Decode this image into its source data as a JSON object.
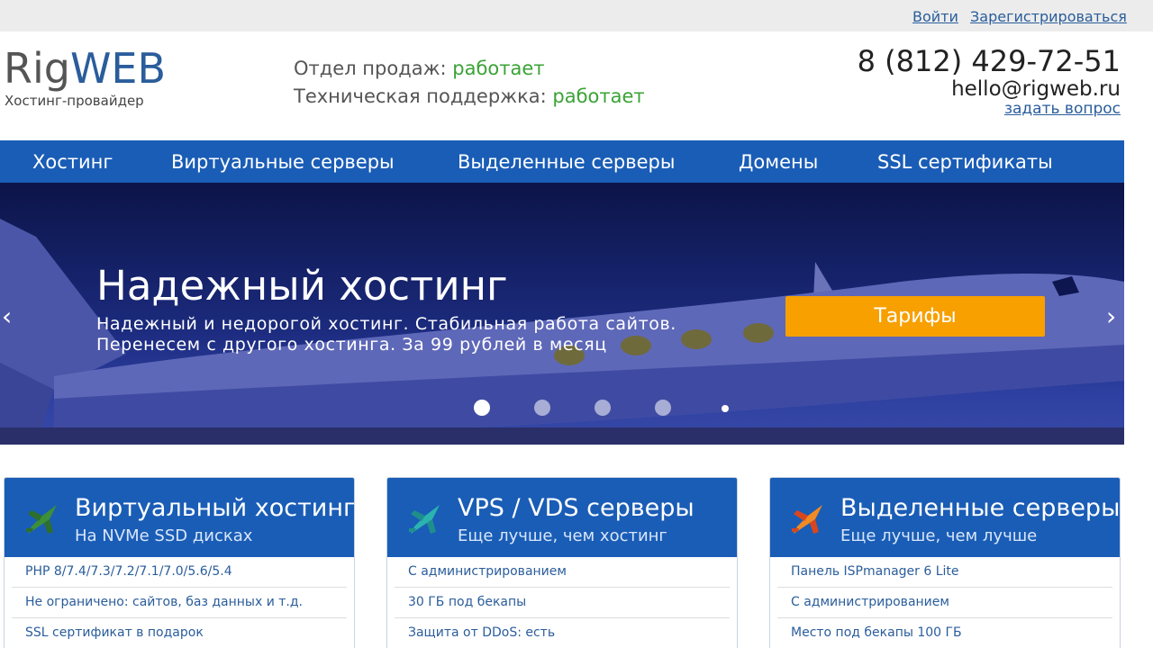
{
  "topbar": {
    "login": "Войти",
    "register": "Зарегистрироваться"
  },
  "header": {
    "logo_part1": "Rig",
    "logo_part2": "WEB",
    "tagline": "Хостинг-провайдер",
    "sales_label": "Отдел продаж:",
    "sales_status": "работает",
    "support_label": "Техническая поддержка:",
    "support_status": "работает",
    "phone": "8 (812) 429-72-51",
    "email": "hello@rigweb.ru",
    "ask_link": "задать вопрос",
    "status_color": "#3aa335"
  },
  "nav": {
    "items": [
      {
        "label": "Хостинг"
      },
      {
        "label": "Виртуальные серверы"
      },
      {
        "label": "Выделенные серверы"
      },
      {
        "label": "Домены"
      },
      {
        "label": "SSL сертификаты"
      }
    ],
    "background": "#1a5db6"
  },
  "hero": {
    "title": "Надежный хостинг",
    "text_line1": "Надежный и недорогой хостинг. Стабильная работа сайтов.",
    "text_line2": "Перенесем с другого хостинга. За 99 рублей в месяц",
    "button": "Тарифы",
    "button_color": "#f7a000",
    "prev_icon": "‹",
    "next_icon": "›",
    "slides_total": 4,
    "active_slide": 1
  },
  "cards": [
    {
      "title": "Виртуальный хостинг",
      "subtitle": "На NVMe SSD дисках",
      "icon": "green-jet-icon",
      "features": [
        "PHP 8/7.4/7.3/7.2/7.1/7.0/5.6/5.4",
        "Не ограничено: сайтов, баз данных и т.д.",
        "SSL сертификат в подарок"
      ]
    },
    {
      "title": "VPS / VDS серверы",
      "subtitle": "Еще лучше, чем хостинг",
      "icon": "teal-jet-icon",
      "features": [
        "С администрированием",
        "30 ГБ под бекапы",
        "Защита от DDoS: есть"
      ]
    },
    {
      "title": "Выделенные серверы",
      "subtitle": "Еще лучше, чем лучше",
      "icon": "orange-jet-icon",
      "features": [
        "Панель ISPmanager 6 Lite",
        "С администрированием",
        "Место под бекапы 100 ГБ"
      ]
    }
  ]
}
